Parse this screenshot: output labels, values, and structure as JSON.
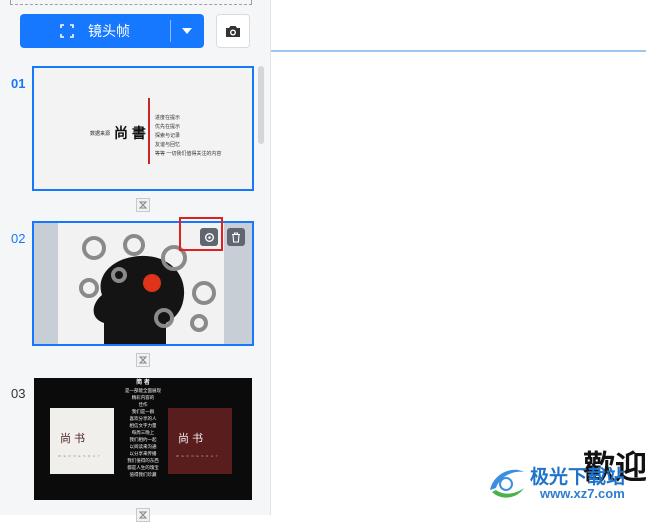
{
  "toolbar": {
    "shot_label": "镜头帧",
    "shot_icon": "frame-icon",
    "dropdown_icon": "caret-down-icon",
    "camera_icon": "camera-icon",
    "accent": "#1677ff"
  },
  "slides": [
    {
      "number": "01",
      "left_caption": "数据来源",
      "title": "尚 書",
      "lines": [
        "进度在提示",
        "优先在提示",
        "探索与记录",
        "友谊与回忆",
        "等等 一切我们值得关注的内容"
      ]
    },
    {
      "number": "02",
      "overlay_buttons": [
        "settings-icon",
        "delete-icon"
      ]
    },
    {
      "number": "03",
      "card_left_label": "尚 书",
      "card_left_sub": "W E D N E S D A Y",
      "card_right_label": "尚 书",
      "card_right_sub": "W E D N E S D A Y",
      "middle_lines": [
        "简 者",
        "是一部能全面展现",
        "精彩内容的",
        "佳作",
        "",
        "我们是一群",
        "喜欢分享的人",
        "相信文字力量",
        "",
        "每周三晚上",
        "我们相约一起",
        "以阅读来沟通",
        "以分享来传播",
        "我们值得的东西",
        "都是人生的瑰宝",
        "值得我们珍藏"
      ]
    }
  ],
  "canvas": {
    "welcome_text": "歡迎",
    "watermark_text": "极光下载站",
    "watermark_url": "www.xz7.com"
  }
}
